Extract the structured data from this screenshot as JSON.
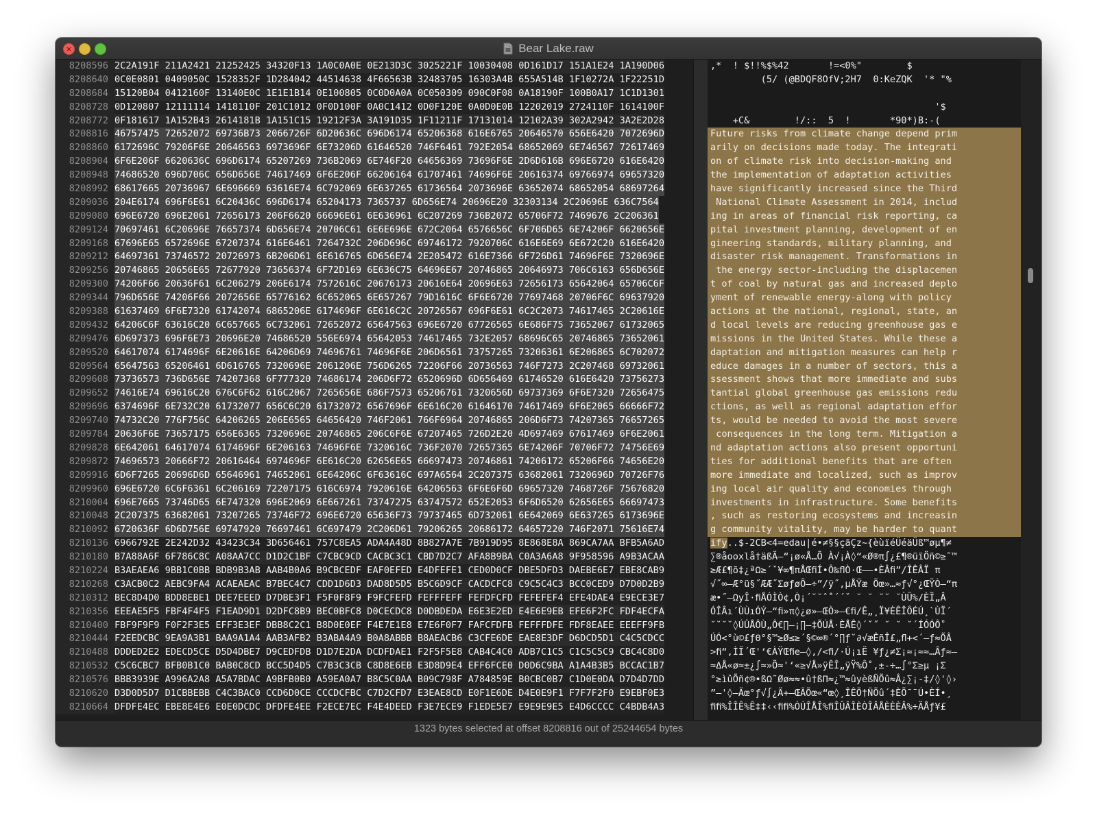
{
  "window": {
    "title": "Bear Lake.raw"
  },
  "hex_rows": [
    {
      "offset": "8208596",
      "hex": "2C2A191F 211A2421 21252425 34320F13 1A0C0A0E 0E213D3C 3025221F 10030408 0D161D17 151A1E24 1A190D06",
      "selected": false
    },
    {
      "offset": "8208640",
      "hex": "0C0E0801 0409050C 1528352F 1D284042 44514638 4F66563B 32483705 16303A4B 655A514B 1F10272A 1F22251D",
      "selected": false
    },
    {
      "offset": "8208684",
      "hex": "15120B04 0412160F 13140E0C 1E1E1B14 0E100805 0C0D0A0A 0C050309 090C0F08 0A18190F 100B0A17 1C1D1301",
      "selected": false
    },
    {
      "offset": "8208728",
      "hex": "0D120807 12111114 1418110F 201C1012 0F0D100F 0A0C1412 0D0F120E 0A0D0E0B 12202019 2724110F 1614100F",
      "selected": false
    },
    {
      "offset": "8208772",
      "hex": "0F181617 1A152B43 2614181B 1A151C15 19212F3A 3A191D35 1F11211F 17131014 12102A39 302A2942 3A2E2D28",
      "selected": false
    },
    {
      "offset": "8208816",
      "hex": "46757475 72652072 69736B73 2066726F 6D20636C 696D6174 65206368 616E6765 20646570 656E6420 7072696D",
      "selected": true
    },
    {
      "offset": "8208860",
      "hex": "6172696C 79206F6E 20646563 6973696F 6E73206D 61646520 746F6461 792E2054 68652069 6E746567 72617469",
      "selected": true
    },
    {
      "offset": "8208904",
      "hex": "6F6E206F 6620636C 696D6174 65207269 736B2069 6E746F20 64656369 73696F6E 2D6D616B 696E6720 616E6420",
      "selected": true
    },
    {
      "offset": "8208948",
      "hex": "74686520 696D706C 656D656E 74617469 6F6E206F 66206164 61707461 74696F6E 20616374 69766974 69657320",
      "selected": true
    },
    {
      "offset": "8208992",
      "hex": "68617665 20736967 6E696669 63616E74 6C792069 6E637265 61736564 2073696E 63652074 68652054 68697264",
      "selected": true
    },
    {
      "offset": "8209036",
      "hex": "204E6174 696F6E61 6C20436C 696D6174 65204173 7365737 6D656E74 20696E20 32303134 2C20696E 636C7564",
      "selected": true
    },
    {
      "offset": "8209080",
      "hex": "696E6720 696E2061 72656173 206F6620 66696E61 6E636961 6C207269 736B2072 65706F72 7469676 2C206361",
      "selected": true
    },
    {
      "offset": "8209124",
      "hex": "70697461 6C20696E 76657374 6D656E74 20706C61 6E6E696E 672C2064 6576656C 6F706D65 6E74206F 6620656E",
      "selected": true
    },
    {
      "offset": "8209168",
      "hex": "67696E65 6572696E 67207374 616E6461 7264732C 206D696C 69746172 7920706C 616E6E69 6E672C20 616E6420",
      "selected": true
    },
    {
      "offset": "8209212",
      "hex": "64697361 73746572 20726973 6B206D61 6E616765 6D656E74 2E205472 616E7366 6F726D61 74696F6E 7320696E",
      "selected": true
    },
    {
      "offset": "8209256",
      "hex": "20746865 20656E65 72677920 73656374 6F72D169 6E636C75 64696E67 20746865 20646973 706C6163 656D656E",
      "selected": true
    },
    {
      "offset": "8209300",
      "hex": "74206F66 20636F61 6C206279 206E6174 7572616C 20676173 20616E64 20696E63 72656173 65642064 65706C6F",
      "selected": true
    },
    {
      "offset": "8209344",
      "hex": "796D656E 74206F66 2072656E 65776162 6C652065 6E657267 79D1616C 6F6E6720 77697468 20706F6C 69637920",
      "selected": true
    },
    {
      "offset": "8209388",
      "hex": "61637469 6F6E7320 61742074 6865206E 6174696F 6E616C2C 20726567 696F6E61 6C2C2073 74617465 2C20616E",
      "selected": true
    },
    {
      "offset": "8209432",
      "hex": "64206C6F 63616C20 6C657665 6C732061 72652072 65647563 696E6720 67726565 6E686F75 73652067 61732065",
      "selected": true
    },
    {
      "offset": "8209476",
      "hex": "6D697373 696F6E73 20696E20 74686520 556E6974 65642053 74617465 732E2057 68696C65 20746865 73652061",
      "selected": true
    },
    {
      "offset": "8209520",
      "hex": "64617074 6174696F 6E20616E 64206D69 74696761 74696F6E 206D6561 73757265 73206361 6E206865 6C702072",
      "selected": true
    },
    {
      "offset": "8209564",
      "hex": "65647563 65206461 6D616765 7320696E 2061206E 756D6265 72206F66 20736563 746F7273 2C207468 69732061",
      "selected": true
    },
    {
      "offset": "8209608",
      "hex": "73736573 736D656E 74207368 6F777320 74686174 206D6F72 6520696D 6D656469 61746520 616E6420 73756273",
      "selected": true
    },
    {
      "offset": "8209652",
      "hex": "74616E74 69616C20 676C6F62 616C2067 7265656E 686F7573 65206761 7320656D 69737369 6F6E7320 72656475",
      "selected": true
    },
    {
      "offset": "8209696",
      "hex": "6374696F 6E732C20 61732077 656C6C20 61732072 6567696F 6E616C20 61646170 74617469 6F6E2065 66666F72",
      "selected": true
    },
    {
      "offset": "8209740",
      "hex": "74732C20 776F756C 64206265 206E6565 64656420 746F2061 766F6964 20746865 206D6F73 74207365 76657265",
      "selected": true
    },
    {
      "offset": "8209784",
      "hex": "20636F6E 73657175 656E6365 7320696E 20746865 206C6F6E 67207465 726D2E20 4D697469 67617469 6F6E2061",
      "selected": true
    },
    {
      "offset": "8209828",
      "hex": "6E642061 64617074 6174696F 6E206163 74696F6E 7320616C 736F2070 72657365 6E74206F 70706F72 74756E69",
      "selected": true
    },
    {
      "offset": "8209872",
      "hex": "74696573 20666F72 20616464 6974696F 6E616C20 62656E65 66697473 20746861 74206172 65206F66 74656E20",
      "selected": true
    },
    {
      "offset": "8209916",
      "hex": "6D6F7265 20696D6D 65646961 74652061 6E64206C 6F63616C 697A6564 2C207375 63682061 7320696D 70726F76",
      "selected": true
    },
    {
      "offset": "8209960",
      "hex": "696E6720 6C6F6361 6C206169 72207175 616C6974 7920616E 64206563 6F6E6F6D 69657320 7468726F 75676820",
      "selected": true
    },
    {
      "offset": "8210004",
      "hex": "696E7665 73746D65 6E747320 696E2069 6E667261 73747275 63747572 652E2053 6F6D6520 62656E65 66697473",
      "selected": true
    },
    {
      "offset": "8210048",
      "hex": "2C207375 63682061 73207265 73746F72 696E6720 65636F73 79737465 6D732061 6E642069 6E637265 6173696E",
      "selected": true
    },
    {
      "offset": "8210092",
      "hex": "6720636F 6D6D756E 69747920 76697461 6C697479 2C206D61 79206265 20686172 64657220 746F2071 75616E74",
      "selected": true
    },
    {
      "offset": "8210136",
      "hex": "6966792E 2E242D32 43423C34 3D656461 757C8EA5 ADA4A48D 8B827A7E 7B919D95 8E868E8A 869CA7AA BFB5A6AD",
      "selected": false
    },
    {
      "offset": "8210180",
      "hex": "B7A88A6F 6F786C8C A08AA7CC D1D2C1BF C7CBC9CD CACBC3C1 CBD7D2C7 AFA8B9BA C0A3A6A8 9F958596 A9B3ACAA",
      "selected": false
    },
    {
      "offset": "8210224",
      "hex": "B3AEAEA6 9BB1C0BB BDB9B3AB AAB4B0A6 B9CBCEDF EAF0EFED E4DFEFE1 CED0D0CF DBE5DFD3 DAEBE6E7 EBE8CAB9",
      "selected": false
    },
    {
      "offset": "8210268",
      "hex": "C3ACB0C2 AEBC9FA4 ACAEAEAC B7BEC4C7 CDD1D6D3 DAD8D5D5 B5C6D9CF CACDCFC8 C9C5C4C3 BCC0CED9 D7D0D2B9",
      "selected": false
    },
    {
      "offset": "8210312",
      "hex": "BEC8D4D0 BDD8EBE1 DEE7EEED D7DBE3F1 F5F0F8F9 F9FCFEFD FEFFFEFF FEFDFCFD FEFEFEF4 EFE4DAE4 E9ECE3E7",
      "selected": false
    },
    {
      "offset": "8210356",
      "hex": "EEEAE5F5 FBF4F4F5 F1EAD9D1 D2DFC8B9 BEC0BFC8 D0CECDC8 D0DBDEDA E6E3E2ED E4E6E9EB EFE6F2FC FDF4ECFA",
      "selected": false
    },
    {
      "offset": "8210400",
      "hex": "FBF9F9F9 F0F2F3E5 EFF3E3EF DBB8C2C1 B8D0E0EF F4E7E1E8 E7E6F0F7 FAFCFDFB FEFFFDFE FDF8EAEE EEEFF9FB",
      "selected": false
    },
    {
      "offset": "8210444",
      "hex": "F2EEDCBC 9EA9A3B1 BAA9A1A4 AAB3AFB2 B3ABA4A9 B0A8ABBB B8AEACB6 C3CFE6DE EAE8E3DF D6DCD5D1 C4C5CDCC",
      "selected": false
    },
    {
      "offset": "8210488",
      "hex": "DDDED2E2 EDECD5CE D5D4DBE7 D9CEDFDB D1D7E2DA DCDFDAE1 F2F5F5E8 CAB4C4C0 ADB7C1C5 C1C5C5C9 CBC4C8D0",
      "selected": false
    },
    {
      "offset": "8210532",
      "hex": "C5C6CBC7 BFB0B1C0 BAB0C8CD BCC5D4D5 C7B3C3CB C8D8E6EB E3D8D9E4 EFF6FCE0 D0D6C9BA A1A4B3B5 BCCAC1B7",
      "selected": false
    },
    {
      "offset": "8210576",
      "hex": "BBB3939E A996A2A8 A5A7BDAC A9BFB0B0 A59EA0A7 B8C5C0AA B09C798F A784859E B0CBC0B7 C1D0E0DA D7D4D7DD",
      "selected": false
    },
    {
      "offset": "8210620",
      "hex": "D3D0D5D7 D1CBBEBB C4C3BAC0 CCD6D0CE CCCDCFBC C7D2CFD7 E3EAE8CD E0F1E6DE D4E0E9F1 F7F7F2F0 E9EBF0E3",
      "selected": false
    },
    {
      "offset": "8210664",
      "hex": "DFDFE4EC EBE8E4E6 E0E0DCDC DFDFE4EE F2ECE7EC F4E4DEED F3E7ECE9 F1EDE5E7 E9E9E9E5 E4D6CCCC C4BDB4A3",
      "selected": false
    }
  ],
  "ascii_rows": [
    {
      "text": ",*  ! $!!%$%42       !=<0%\"        $",
      "selected": false
    },
    {
      "text": "         (5/ (@BDQF8OfV;2H7  0:KeZQK  '* \"%",
      "selected": false
    },
    {
      "text": "",
      "selected": false
    },
    {
      "text": "                                        '$",
      "selected": false
    },
    {
      "text": "    +C&        !/::  5  !       *90*)B:-(",
      "selected": false
    },
    {
      "text": "Future risks from climate change depend prim",
      "selected": true
    },
    {
      "text": "arily on decisions made today. The integrati",
      "selected": true
    },
    {
      "text": "on of climate risk into decision-making and ",
      "selected": true
    },
    {
      "text": "the implementation of adaptation activities ",
      "selected": true
    },
    {
      "text": "have significantly increased since the Third",
      "selected": true
    },
    {
      "text": " National Climate Assessment in 2014, includ",
      "selected": true
    },
    {
      "text": "ing in areas of financial risk reporting, ca",
      "selected": true
    },
    {
      "text": "pital investment planning, development of en",
      "selected": true
    },
    {
      "text": "gineering standards, military planning, and ",
      "selected": true
    },
    {
      "text": "disaster risk management. Transformations in",
      "selected": true
    },
    {
      "text": " the energy sector-including the displacemen",
      "selected": true
    },
    {
      "text": "t of coal by natural gas and increased deplo",
      "selected": true
    },
    {
      "text": "yment of renewable energy-along with policy ",
      "selected": true
    },
    {
      "text": "actions at the national, regional, state, an",
      "selected": true
    },
    {
      "text": "d local levels are reducing greenhouse gas e",
      "selected": true
    },
    {
      "text": "missions in the United States. While these a",
      "selected": true
    },
    {
      "text": "daptation and mitigation measures can help r",
      "selected": true
    },
    {
      "text": "educe damages in a number of sectors, this a",
      "selected": true
    },
    {
      "text": "ssessment shows that more immediate and subs",
      "selected": true
    },
    {
      "text": "tantial global greenhouse gas emissions redu",
      "selected": true
    },
    {
      "text": "ctions, as well as regional adaptation effor",
      "selected": true
    },
    {
      "text": "ts, would be needed to avoid the most severe",
      "selected": true
    },
    {
      "text": " consequences in the long term. Mitigation a",
      "selected": true
    },
    {
      "text": "nd adaptation actions also present opportuni",
      "selected": true
    },
    {
      "text": "ties for additional benefits that are often ",
      "selected": true
    },
    {
      "text": "more immediate and localized, such as improv",
      "selected": true
    },
    {
      "text": "ing local air quality and economies through ",
      "selected": true
    },
    {
      "text": "investments in infrastructure. Some benefits",
      "selected": true
    },
    {
      "text": ", such as restoring ecosystems and increasin",
      "selected": true
    },
    {
      "text": "g community vitality, may be harder to quant",
      "selected": true
    },
    {
      "text": "ify..$-2CB<4=edau|é•≠§§çãÇz~{èùïéÜéäÜß™øµ¶≠",
      "selected": false,
      "selected_prefix": "ify"
    },
    {
      "text": "∑®åooxlå†äßÄ–“¡ø«Å…Õ À√¡À◊“«Ø®π∫¿£¶®üïÖñ©≥˜™",
      "selected": false
    },
    {
      "text": "≥Æ£¶õ‡¿ªΩ≥´ˇ¥∞¶πÅŒﬁÍ•Ô‰ﬂÒ·Œ––•ÈÂﬁ”/ÎÊÂÏ π",
      "selected": false
    },
    {
      "text": "√˝∞–Æ°ü§˝ÆÆ˝ΣøƒøÕ–÷”/ÿ˝‚µÅŸæ Õœ»…≈ƒ√°¿ŒŸÒ–“π",
      "selected": false
    },
    {
      "text": "æ•˝–ΩyÎ·ﬁÅÓÌÒ¢‚Ò¡´˘˘ˆ˚´´ˇ ˘ ˘ ˘˘ ˘ÙÛ%/ÈÏ„Â",
      "selected": false
    },
    {
      "text": "ÓÎÂı´ÙÙıÓÝ–“ﬁ»π◊¿ø»–ŒÒ»–€ﬁ/Ê„¸Ï¥ÈÊÎÔÉÚ¸`ÙÏ´",
      "selected": false
    },
    {
      "text": "˘˘˘˘◊ÚÛÅÔÙ„Ô€∏–¡∏–‡ÕÚÅ·ÈÅÊ◊´ˇ˝ ˘ ˘ ˘´ÍÓÓÔ˚",
      "selected": false
    },
    {
      "text": "ÚÓ<°ù©£ƒΘ°§™≥Ø≤≥´§©∞®´°∏ƒ˘∂√æÊñÎ£„ﬂ+<´–ƒ≈ÕÂ",
      "selected": false
    },
    {
      "text": ">ﬁ“‚ÌÏ´Œ'‘€ÀŸŒﬁe–◊,/<ﬁ/·Ú¡ıË ¥ƒ¿≠Σ¡≈¡≈≈…Âƒ≈–",
      "selected": false
    },
    {
      "text": "≈ΔÅ«ø≈±¿∫≈»Õ≈'‘«≥√Å»ÿÊÎ„ÿŸ%Ô˚‚±-÷…∫°Σ≥µ ¡Σ",
      "selected": false
    },
    {
      "text": "°≥ìûÕñ¢®•ßΩ˜Øø≈≈•û†ßΠ≈¿™≈ûyèßÑÕû≈Â¿∑¡-‡/◊'◊›",
      "selected": false
    },
    {
      "text": "”–'◊–Äœ°ƒ√∫¿Ä+–ŒÃÕœ«“œ◊¸ÎÊÕ†ÑÕû´‡ÈÕ¯¯Ú•ÈÍ•¸",
      "selected": false
    },
    {
      "text": "ﬁﬁ%ÎÎÊ%Ê‡‡‹‹ﬁﬁ%ÓÚÎÅÎ%ﬁÎÛÂÎÈÒÎÂÅÈÈÈÂ%÷ÄÅƒ¥£",
      "selected": false
    }
  ],
  "status": {
    "text": "1323 bytes selected at offset 8208816 out of 25244654 bytes"
  },
  "colors": {
    "selection_ascii": "#8c7549",
    "selection_hex": "#454545",
    "background": "#1e1e1e"
  }
}
